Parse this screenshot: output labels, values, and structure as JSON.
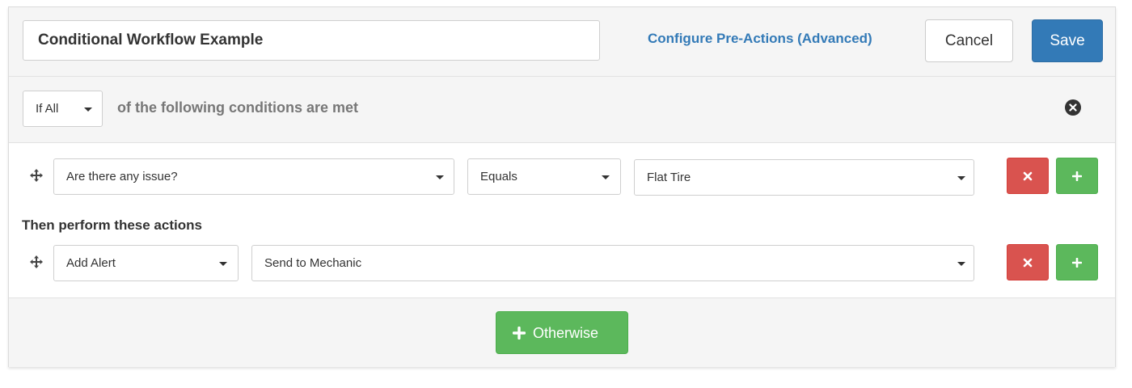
{
  "header": {
    "title_value": "Conditional Workflow Example",
    "config_link": "Configure Pre-Actions (Advanced)",
    "cancel_label": "Cancel",
    "save_label": "Save"
  },
  "conditions_bar": {
    "match_select": "If All",
    "text": "of the following conditions are met"
  },
  "condition_row": {
    "field": "Are there any issue?",
    "operator": "Equals",
    "value": "Flat Tire"
  },
  "actions": {
    "heading": "Then perform these actions",
    "action_type": "Add Alert",
    "action_target": "Send to Mechanic"
  },
  "footer": {
    "otherwise_label": "Otherwise"
  },
  "icons": {
    "move": "move-arrows-icon",
    "remove": "times-icon",
    "add": "plus-icon",
    "close": "times-circle-icon"
  },
  "colors": {
    "primary": "#337ab7",
    "danger": "#d9534f",
    "success": "#5cb85c",
    "panel_bg": "#f5f5f5"
  }
}
